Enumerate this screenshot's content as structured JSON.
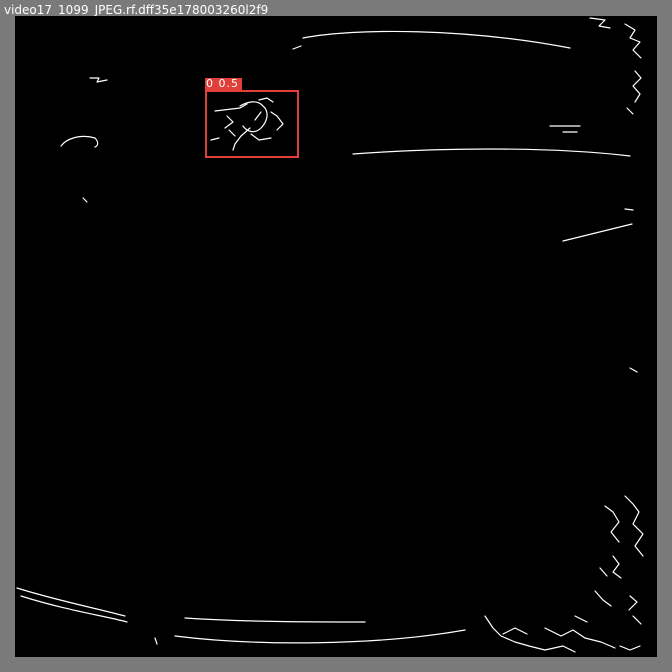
{
  "file_title": "video17_1099_JPEG.rf.dff35e178003260l2f9",
  "image": {
    "description_kind": "edge-detection",
    "background_color": "#000000",
    "edge_color": "#ffffff",
    "frame_color": "#7a7a7a"
  },
  "detections": [
    {
      "label": "0 0.5",
      "color": "#e0403a"
    }
  ]
}
